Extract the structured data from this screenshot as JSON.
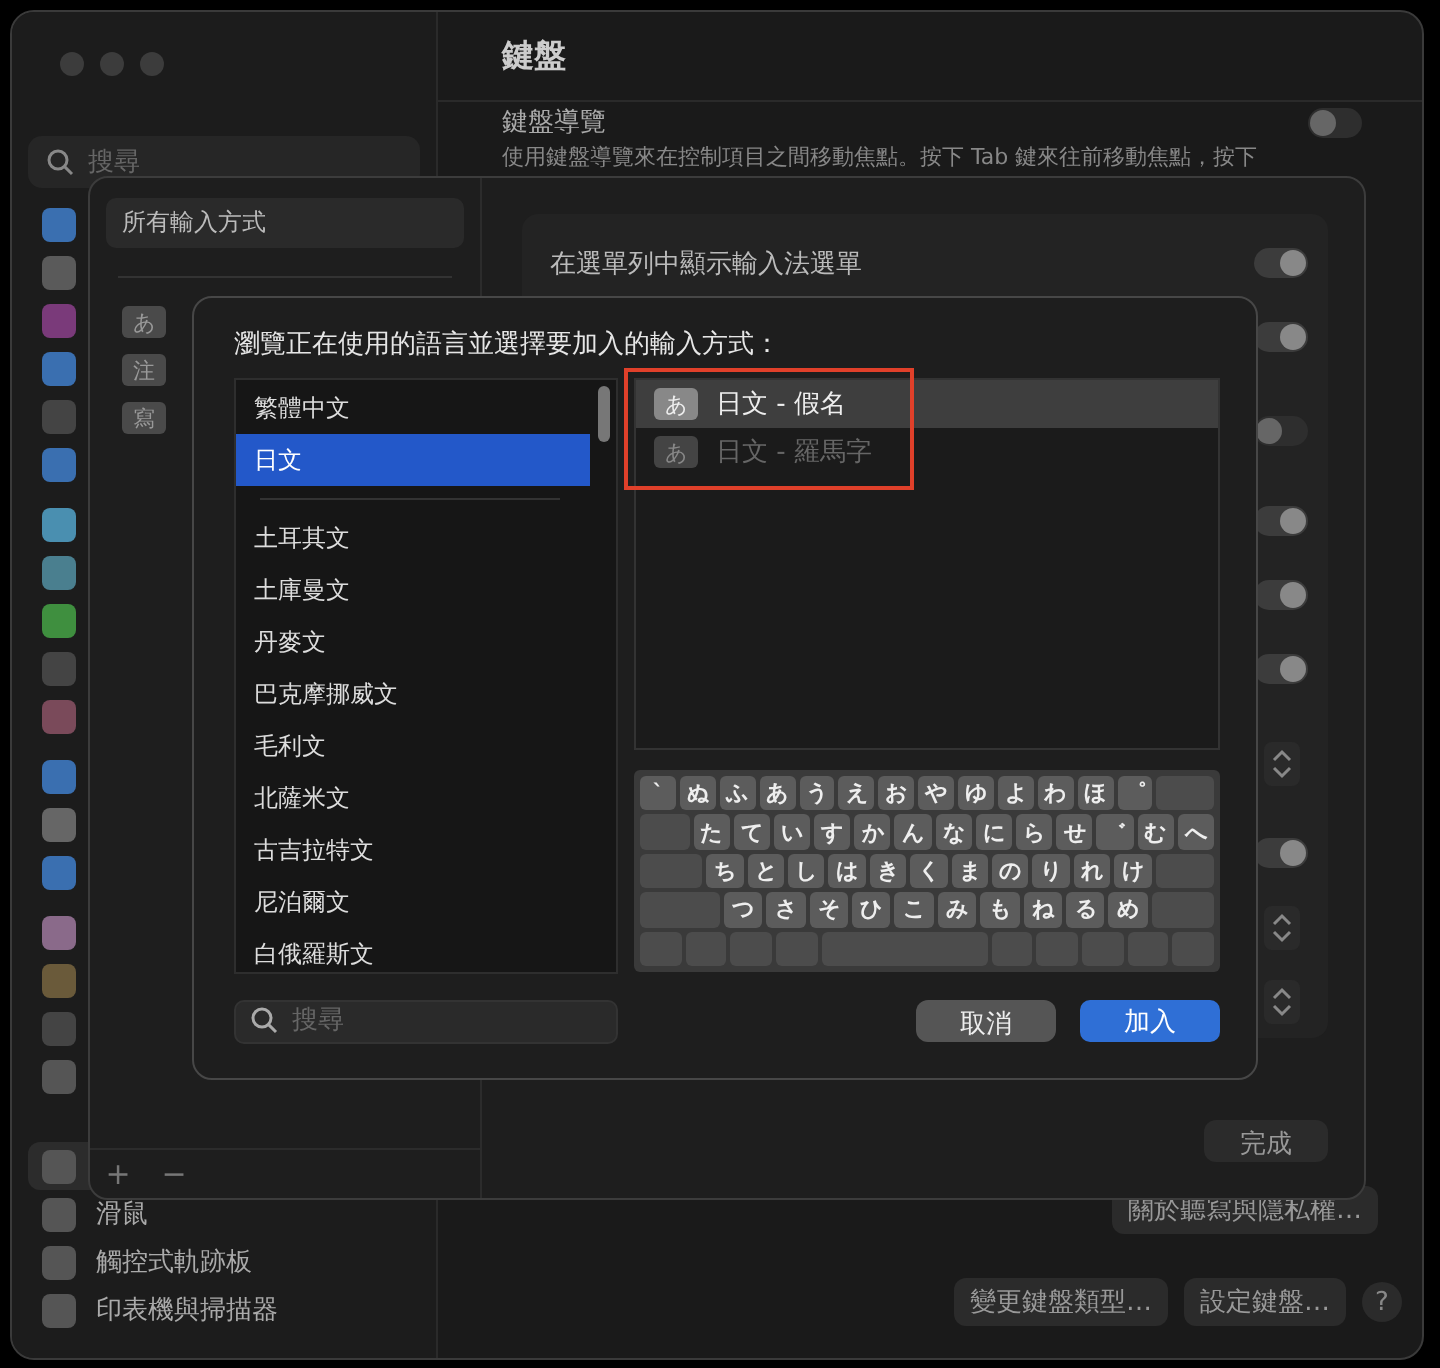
{
  "window": {
    "title": "鍵盤",
    "search": {
      "placeholder": "搜尋"
    },
    "section": {
      "title": "鍵盤導覽",
      "description": "使用鍵盤導覽來在控制項目之間移動焦點。按下 Tab 鍵來往前移動焦點，按下",
      "on": false
    },
    "sidebar": {
      "items": [
        {
          "label": "滑鼠",
          "selected": false
        },
        {
          "label": "觸控式軌跡板",
          "selected": false
        },
        {
          "label": "印表機與掃描器",
          "selected": false
        }
      ]
    },
    "privacy_button": "關於聽寫與隱私權…",
    "buttons": [
      "變更鍵盤類型…",
      "設定鍵盤…"
    ],
    "help": "?"
  },
  "input_sources_sheet": {
    "sidebar_title": "所有輸入方式",
    "sources": [
      {
        "badge": "あ"
      },
      {
        "badge": "注"
      },
      {
        "badge": "寫"
      }
    ],
    "add": "+",
    "remove": "−",
    "settings": [
      {
        "kind": "toggle",
        "label": "在選單列中顯示輸入法選單",
        "on": true
      },
      {
        "kind": "toggle",
        "on": true
      },
      {
        "kind": "toggle",
        "on": false
      },
      {
        "kind": "toggle",
        "on": true
      },
      {
        "kind": "toggle",
        "on": true
      },
      {
        "kind": "toggle",
        "on": true
      },
      {
        "kind": "stepper"
      },
      {
        "kind": "toggle",
        "on": true
      },
      {
        "kind": "stepper"
      },
      {
        "kind": "stepper"
      }
    ],
    "done": "完成"
  },
  "dialog": {
    "title": "瀏覽正在使用的語言並選擇要加入的輸入方式：",
    "languages": [
      {
        "label": "繁體中文",
        "selected": false
      },
      {
        "label": "日文",
        "selected": true
      },
      {
        "label": "土耳其文",
        "selected": false
      },
      {
        "label": "土庫曼文",
        "selected": false
      },
      {
        "label": "丹麥文",
        "selected": false
      },
      {
        "label": "巴克摩挪威文",
        "selected": false
      },
      {
        "label": "毛利文",
        "selected": false
      },
      {
        "label": "北薩米文",
        "selected": false
      },
      {
        "label": "古吉拉特文",
        "selected": false
      },
      {
        "label": "尼泊爾文",
        "selected": false
      },
      {
        "label": "白俄羅斯文",
        "selected": false
      }
    ],
    "methods": [
      {
        "badge": "あ",
        "label": "日文 - 假名",
        "selected": true,
        "disabled": false
      },
      {
        "badge": "あ",
        "label": "日文 - 羅馬字",
        "selected": false,
        "disabled": true
      }
    ],
    "keyboard": [
      [
        "`",
        "ぬ",
        "ふ",
        "あ",
        "う",
        "え",
        "お",
        "や",
        "ゆ",
        "よ",
        "わ",
        "ほ",
        "゜"
      ],
      [
        "た",
        "て",
        "い",
        "す",
        "か",
        "ん",
        "な",
        "に",
        "ら",
        "せ",
        "゛",
        "む",
        "へ"
      ],
      [
        "ち",
        "と",
        "し",
        "は",
        "き",
        "く",
        "ま",
        "の",
        "り",
        "れ",
        "け"
      ],
      [
        "つ",
        "さ",
        "そ",
        "ひ",
        "こ",
        "み",
        "も",
        "ね",
        "る",
        "め"
      ]
    ],
    "search": {
      "placeholder": "搜尋"
    },
    "cancel": "取消",
    "add": "加入"
  }
}
